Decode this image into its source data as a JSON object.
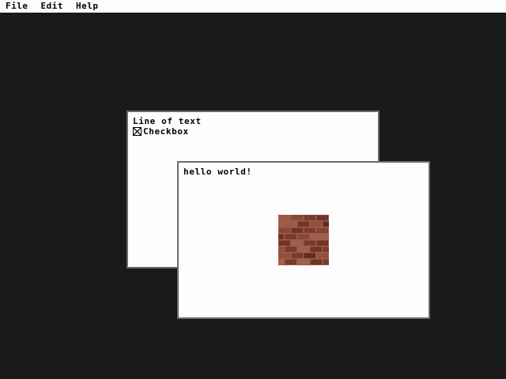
{
  "menubar": {
    "items": [
      "File",
      "Edit",
      "Help"
    ]
  },
  "back_window": {
    "text_line": "Line of text",
    "checkbox": {
      "label": "Checkbox",
      "checked": true
    }
  },
  "front_window": {
    "text": "hello world!",
    "image": "brick-texture"
  },
  "colors": {
    "desktop": "#1a1a1a",
    "window_bg": "#fdfdfd",
    "window_border": "#6b6b6b",
    "brick": "#8a4a38",
    "mortar": "#a06a58"
  }
}
